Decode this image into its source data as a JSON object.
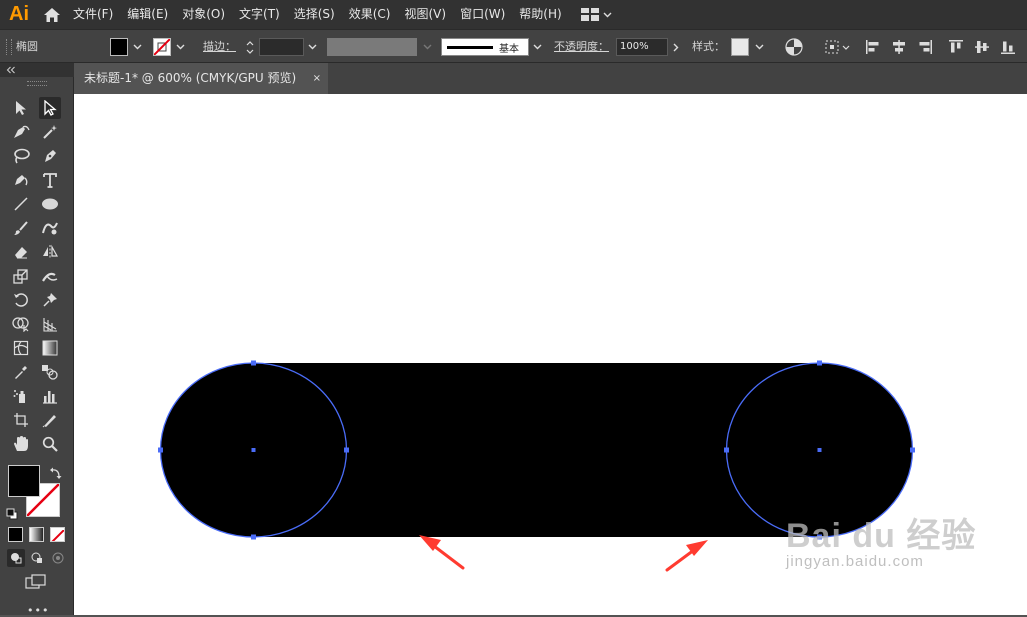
{
  "app": {
    "logo": "Ai"
  },
  "menu": [
    "文件(F)",
    "编辑(E)",
    "对象(O)",
    "文字(T)",
    "选择(S)",
    "效果(C)",
    "视图(V)",
    "窗口(W)",
    "帮助(H)"
  ],
  "control_bar": {
    "object_type": "椭圆",
    "stroke_label": "描边：",
    "stroke_profile": "基本",
    "opacity_label": "不透明度：",
    "opacity_value": "100%",
    "style_label": "样式："
  },
  "document_tab": {
    "title": "未标题-1* @ 600% (CMYK/GPU 预览)",
    "close_glyph": "×"
  },
  "colors": {
    "fill": "#000000",
    "selection": "#4a6cf7",
    "arrow": "#ff3b30",
    "accent": "#ff9a00"
  },
  "watermark": {
    "logo": "Bai du 经验",
    "url": "jingyan.baidu.com"
  }
}
